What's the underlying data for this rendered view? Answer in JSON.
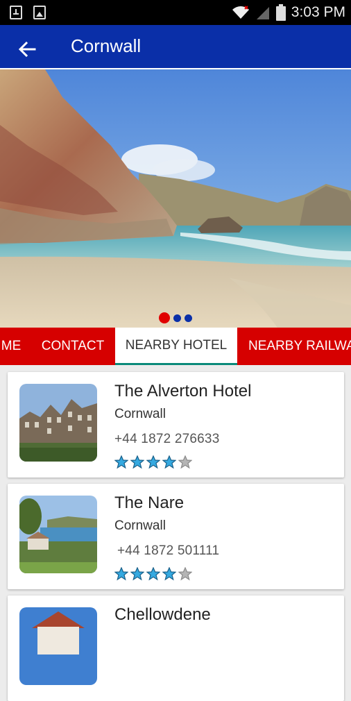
{
  "status": {
    "time": "3:03 PM"
  },
  "header": {
    "title": "Cornwall"
  },
  "carousel": {
    "active": 0,
    "count": 3,
    "colors": {
      "active": "#e00000",
      "inactive": "#0a2fa8"
    }
  },
  "tabs": [
    {
      "label": "ME"
    },
    {
      "label": "CONTACT"
    },
    {
      "label": "NEARBY HOTEL"
    },
    {
      "label": "NEARBY RAILWA"
    }
  ],
  "hotels": [
    {
      "name": "The Alverton Hotel",
      "location": "Cornwall",
      "phone": "+44 1872 276633",
      "rating": 4,
      "max_rating": 5
    },
    {
      "name": "The Nare",
      "location": "Cornwall",
      "phone": "+44 1872 501111",
      "rating": 4,
      "max_rating": 5
    },
    {
      "name": "Chellowdene"
    }
  ],
  "colors": {
    "appbar": "#0a2fa8",
    "tabbar": "#d60000",
    "star_filled": "#35a9e0",
    "star_empty": "#b5b5b5"
  }
}
